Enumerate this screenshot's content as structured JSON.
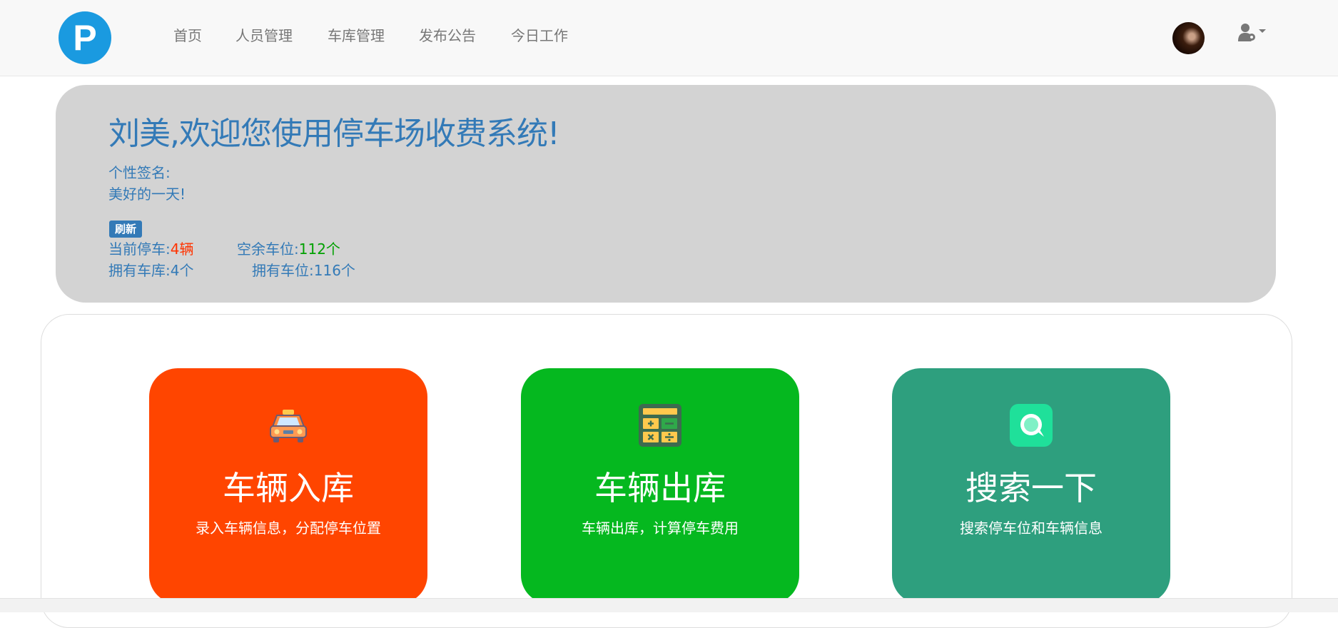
{
  "navbar": {
    "logo_letter": "P",
    "links": [
      "首页",
      "人员管理",
      "车库管理",
      "发布公告",
      "今日工作"
    ]
  },
  "jumbotron": {
    "welcome": "刘美,欢迎您使用停车场收费系统!",
    "signature_label": "个性签名:",
    "signature_text": "美好的一天!",
    "refresh_label": "刷新",
    "stats": {
      "current_parking_label": "当前停车:",
      "current_parking_value": "4辆",
      "free_spaces_label": "空余车位:",
      "free_spaces_value": "112个",
      "garages_label": "拥有车库:",
      "garages_value": "4个",
      "spaces_label": "拥有车位:",
      "spaces_value": "116个"
    }
  },
  "cards": [
    {
      "title": "车辆入库",
      "desc": "录入车辆信息，分配停车位置",
      "color": "#ff4500",
      "icon": "taxi-icon"
    },
    {
      "title": "车辆出库",
      "desc": "车辆出库，计算停车费用",
      "color": "#05b81f",
      "icon": "calculator-icon"
    },
    {
      "title": "搜索一下",
      "desc": "搜索停车位和车辆信息",
      "color": "#2e9f7e",
      "icon": "search-chat-icon"
    }
  ],
  "colors": {
    "accent_blue": "#337ab7",
    "logo_blue": "#1a9ae0",
    "stat_red": "#ff3300",
    "stat_green": "#00a000"
  }
}
